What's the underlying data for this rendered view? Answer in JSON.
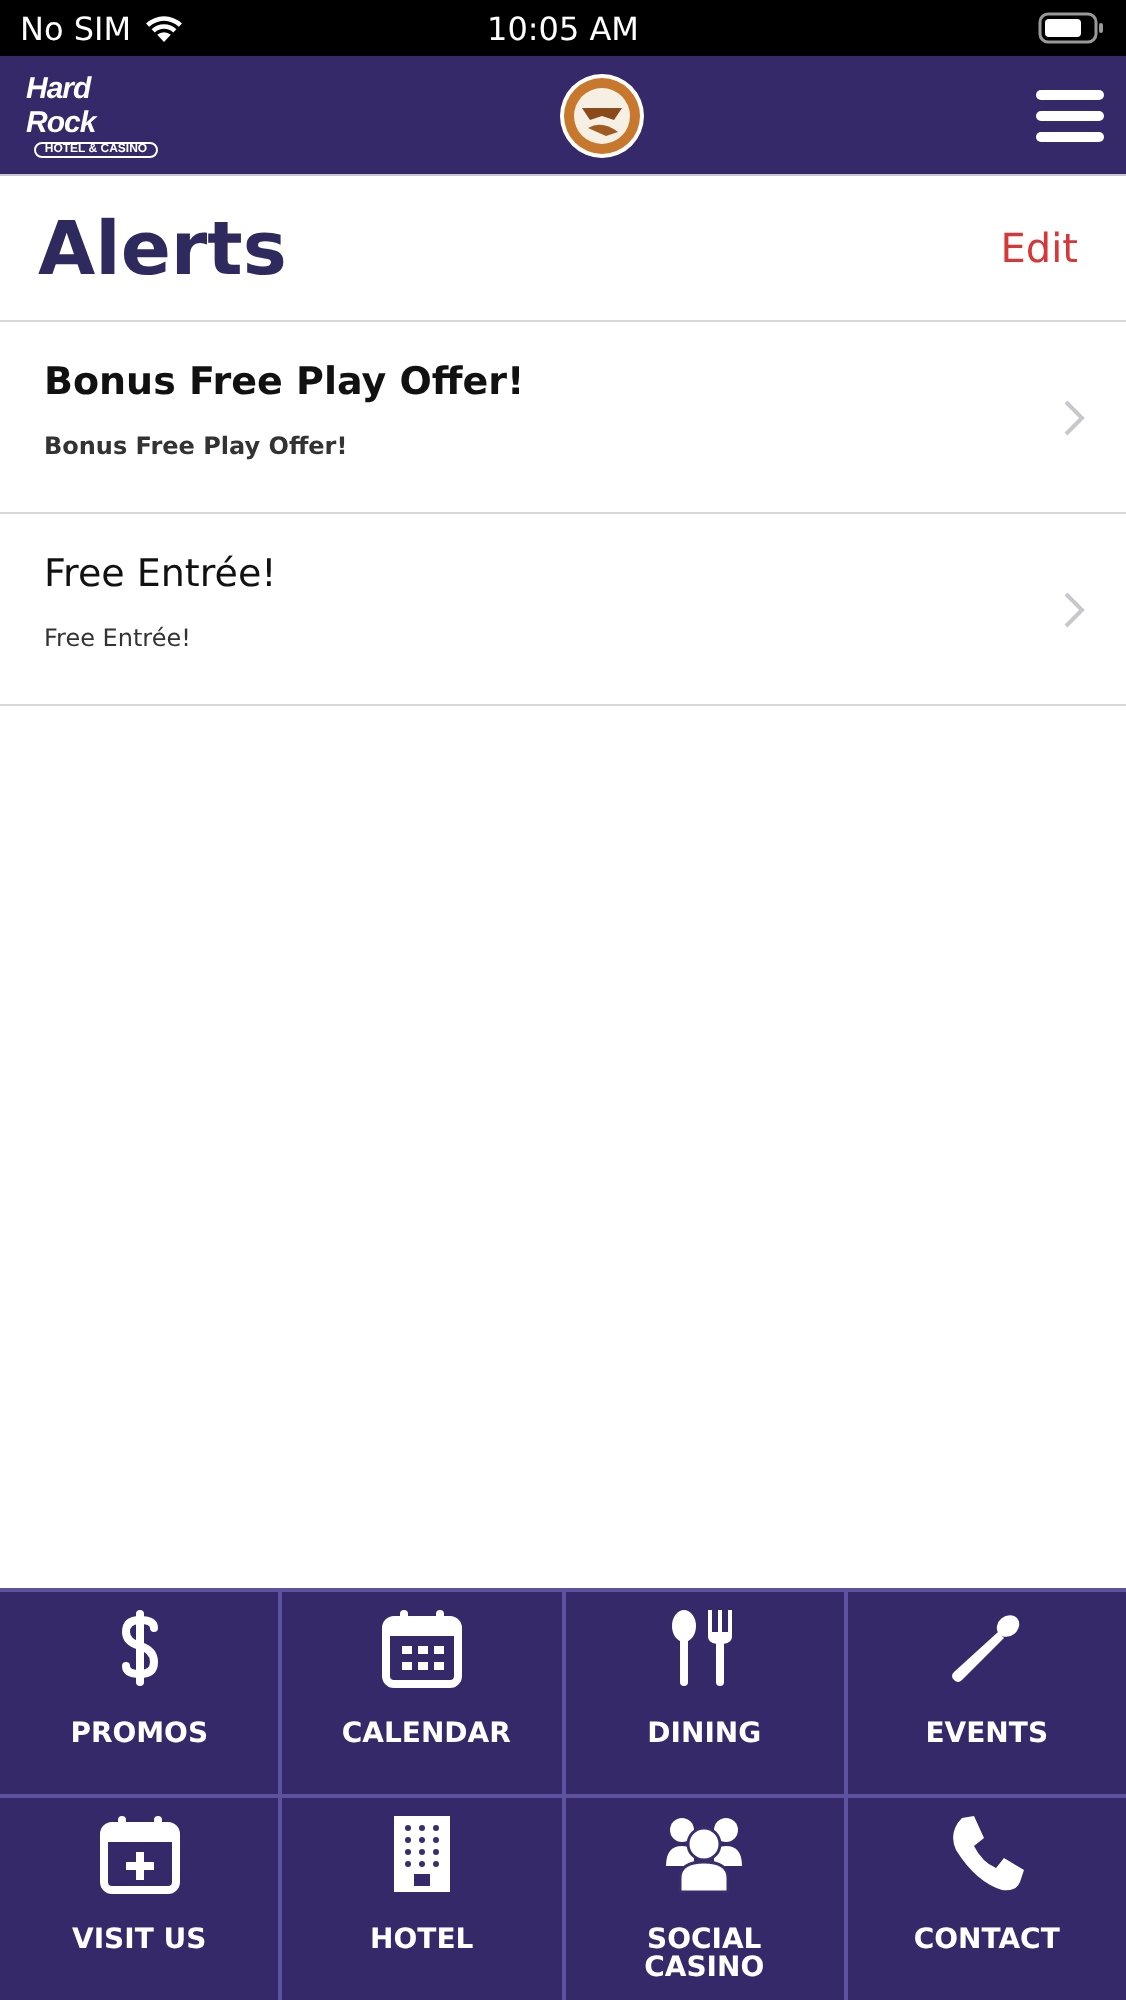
{
  "status_bar": {
    "carrier": "No SIM",
    "time": "10:05 AM"
  },
  "header": {
    "logo": {
      "name": "Hard Rock",
      "tagline": "HOTEL & CASINO"
    }
  },
  "page": {
    "title": "Alerts",
    "edit": "Edit"
  },
  "alerts": [
    {
      "title": "Bonus Free Play Offer!",
      "message": "Bonus Free Play Offer!",
      "unread": true
    },
    {
      "title": "Free Entrée!",
      "message": "Free Entrée!",
      "unread": false
    }
  ],
  "tiles": [
    {
      "kind": "dollar",
      "label": "PROMOS"
    },
    {
      "kind": "calendar",
      "label": "CALENDAR"
    },
    {
      "kind": "dining",
      "label": "DINING"
    },
    {
      "kind": "microphone",
      "label": "EVENTS"
    },
    {
      "kind": "calendar-plus",
      "label": "VISIT US"
    },
    {
      "kind": "building",
      "label": "HOTEL"
    },
    {
      "kind": "people",
      "label": "SOCIAL CASINO"
    },
    {
      "kind": "phone",
      "label": "CONTACT"
    }
  ]
}
